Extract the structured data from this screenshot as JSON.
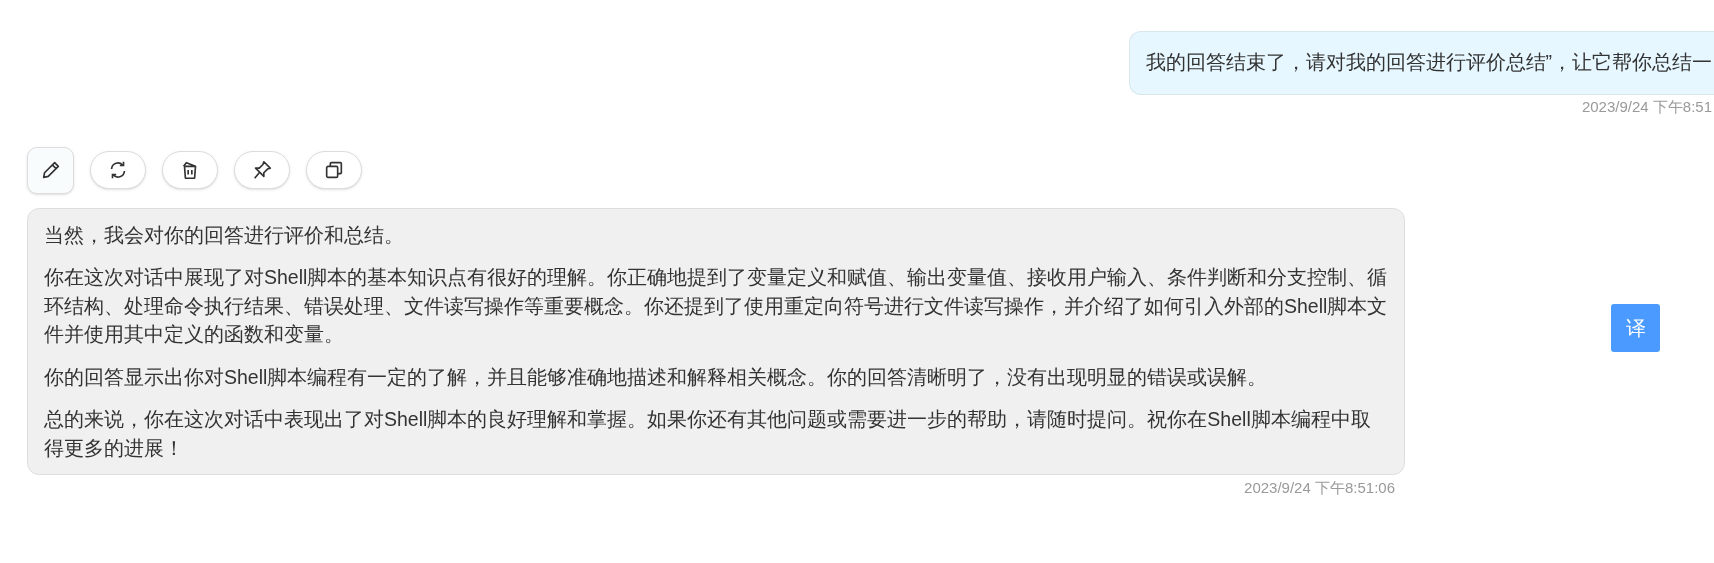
{
  "user_message": {
    "text": "我的回答结束了，请对我的回答进行评价总结”，让它帮你总结一",
    "time": "2023/9/24 下午8:51"
  },
  "toolbar": [
    {
      "kind": "edit"
    },
    {
      "kind": "refresh"
    },
    {
      "kind": "delete"
    },
    {
      "kind": "pin"
    },
    {
      "kind": "copy"
    }
  ],
  "assistant_message": {
    "paragraphs": [
      "当然，我会对你的回答进行评价和总结。",
      "你在这次对话中展现了对Shell脚本的基本知识点有很好的理解。你正确地提到了变量定义和赋值、输出变量值、接收用户输入、条件判断和分支控制、循环结构、处理命令执行结果、错误处理、文件读写操作等重要概念。你还提到了使用重定向符号进行文件读写操作，并介绍了如何引入外部的Shell脚本文件并使用其中定义的函数和变量。",
      "你的回答显示出你对Shell脚本编程有一定的了解，并且能够准确地描述和解释相关概念。你的回答清晰明了，没有出现明显的错误或误解。",
      "总的来说，你在这次对话中表现出了对Shell脚本的良好理解和掌握。如果你还有其他问题或需要进一步的帮助，请随时提问。祝你在Shell脚本编程中取得更多的进展！"
    ],
    "time": "2023/9/24 下午8:51:06"
  },
  "translate_button": "译"
}
